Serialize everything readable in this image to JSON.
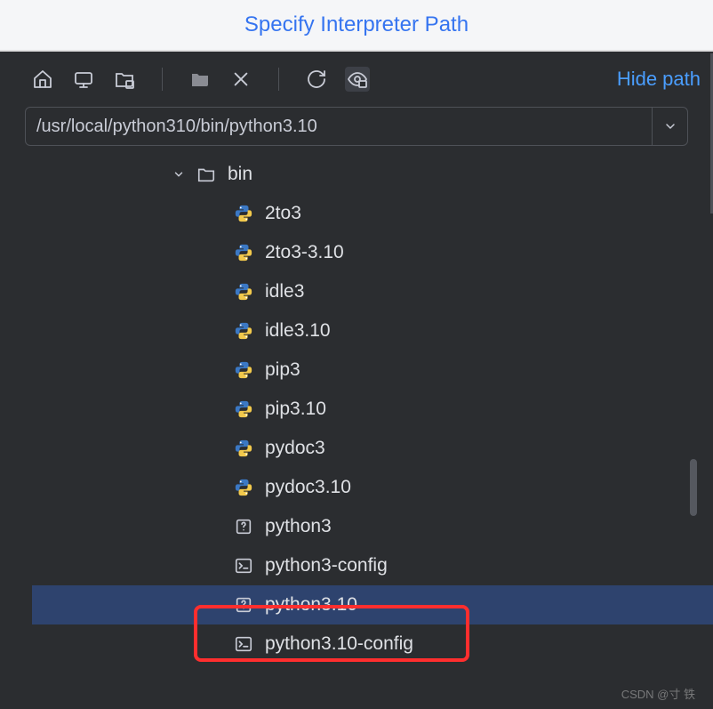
{
  "title": "Specify Interpreter Path",
  "toolbar": {
    "hide_path": "Hide path"
  },
  "path": "/usr/local/python310/bin/python3.10",
  "tree": {
    "folder": "bin",
    "items": [
      {
        "name": "2to3",
        "icon": "python"
      },
      {
        "name": "2to3-3.10",
        "icon": "python"
      },
      {
        "name": "idle3",
        "icon": "python"
      },
      {
        "name": "idle3.10",
        "icon": "python"
      },
      {
        "name": "pip3",
        "icon": "python"
      },
      {
        "name": "pip3.10",
        "icon": "python"
      },
      {
        "name": "pydoc3",
        "icon": "python"
      },
      {
        "name": "pydoc3.10",
        "icon": "python"
      },
      {
        "name": "python3",
        "icon": "unknown"
      },
      {
        "name": "python3-config",
        "icon": "terminal"
      },
      {
        "name": "python3.10",
        "icon": "unknown",
        "selected": true
      },
      {
        "name": "python3.10-config",
        "icon": "terminal"
      }
    ]
  },
  "watermark": "CSDN @寸 铁"
}
